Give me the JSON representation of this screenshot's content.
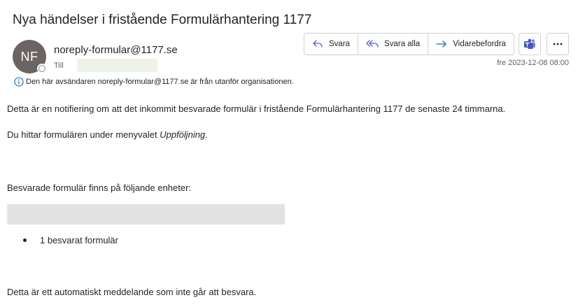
{
  "email": {
    "subject": "Nya händelser i fristående Formulärhantering 1177",
    "sender_initials": "NF",
    "sender_email": "noreply-formular@1177.se",
    "to_label": "Till",
    "date": "fre 2023-12-08 08:00",
    "external_notice": "Den här avsändaren noreply-formular@1177.se är från utanför organisationen."
  },
  "actions": {
    "reply": "Svara",
    "reply_all": "Svara alla",
    "forward": "Vidarebefordra"
  },
  "body": {
    "p1": "Detta är en notifiering om att det inkommit besvarade formulär i fristående Formulärhantering 1177 de senaste 24 timmarna.",
    "p2_prefix": "Du hittar formulären under menyvalet ",
    "p2_italic": "Uppföljning",
    "p2_suffix": ".",
    "p3": "Besvarade formulär finns på följande enheter:",
    "bullet_items": [
      "1 besvarat formulär"
    ],
    "p4": "Detta är ett automatiskt meddelande som inte går att besvara."
  },
  "colors": {
    "avatar_bg": "#6b6462",
    "info_icon": "#0f6cbd",
    "accent": "#5b5fc7"
  }
}
